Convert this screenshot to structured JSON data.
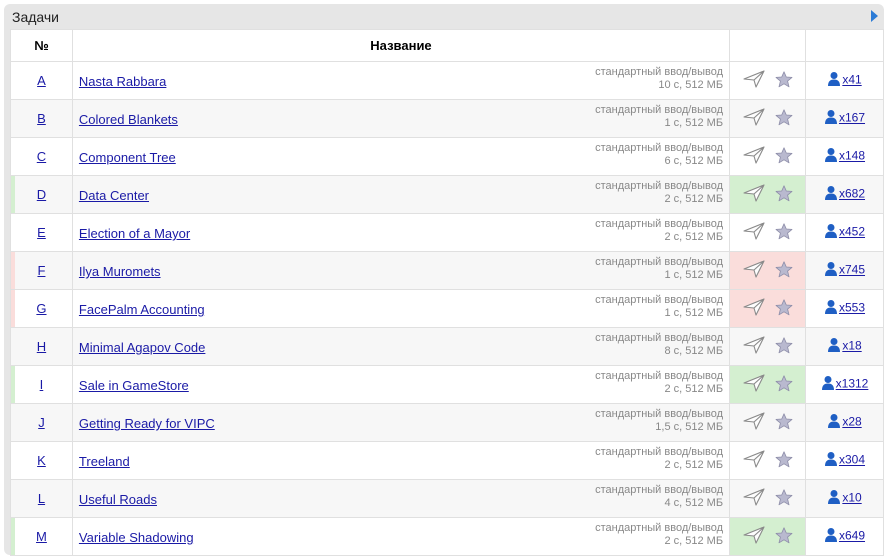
{
  "panel": {
    "title": "Задачи"
  },
  "table": {
    "col_num": "№",
    "col_name": "Название"
  },
  "problems": [
    {
      "index": "A",
      "name": "Nasta Rabbara",
      "io": "стандартный ввод/вывод",
      "limits": "10 с, 512 МБ",
      "solved": "x41",
      "status": "none"
    },
    {
      "index": "B",
      "name": "Colored Blankets",
      "io": "стандартный ввод/вывод",
      "limits": "1 с, 512 МБ",
      "solved": "x167",
      "status": "none"
    },
    {
      "index": "C",
      "name": "Component Tree",
      "io": "стандартный ввод/вывод",
      "limits": "6 с, 512 МБ",
      "solved": "x148",
      "status": "none"
    },
    {
      "index": "D",
      "name": "Data Center",
      "io": "стандартный ввод/вывод",
      "limits": "2 с, 512 МБ",
      "solved": "x682",
      "status": "ok"
    },
    {
      "index": "E",
      "name": "Election of a Mayor",
      "io": "стандартный ввод/вывод",
      "limits": "2 с, 512 МБ",
      "solved": "x452",
      "status": "none"
    },
    {
      "index": "F",
      "name": "Ilya Muromets",
      "io": "стандартный ввод/вывод",
      "limits": "1 с, 512 МБ",
      "solved": "x745",
      "status": "fail"
    },
    {
      "index": "G",
      "name": "FacePalm Accounting",
      "io": "стандартный ввод/вывод",
      "limits": "1 с, 512 МБ",
      "solved": "x553",
      "status": "fail"
    },
    {
      "index": "H",
      "name": "Minimal Agapov Code",
      "io": "стандартный ввод/вывод",
      "limits": "8 с, 512 МБ",
      "solved": "x18",
      "status": "none"
    },
    {
      "index": "I",
      "name": "Sale in GameStore",
      "io": "стандартный ввод/вывод",
      "limits": "2 с, 512 МБ",
      "solved": "x1312",
      "status": "ok"
    },
    {
      "index": "J",
      "name": "Getting Ready for VIPC",
      "io": "стандартный ввод/вывод",
      "limits": "1,5 с, 512 МБ",
      "solved": "x28",
      "status": "none"
    },
    {
      "index": "K",
      "name": "Treeland",
      "io": "стандартный ввод/вывод",
      "limits": "2 с, 512 МБ",
      "solved": "x304",
      "status": "none"
    },
    {
      "index": "L",
      "name": "Useful Roads",
      "io": "стандартный ввод/вывод",
      "limits": "4 с, 512 МБ",
      "solved": "x10",
      "status": "none"
    },
    {
      "index": "M",
      "name": "Variable Shadowing",
      "io": "стандартный ввод/вывод",
      "limits": "2 с, 512 МБ",
      "solved": "x649",
      "status": "ok"
    }
  ],
  "icons": {
    "submit": "paper-plane-icon",
    "favorite": "star-icon",
    "solvers": "user-icon",
    "expand": "triangle-right-icon"
  },
  "colors": {
    "ok": "#d4efd0",
    "fail": "#fadddb",
    "link": "#1a1aa6",
    "panel": "#e6e6e6"
  }
}
